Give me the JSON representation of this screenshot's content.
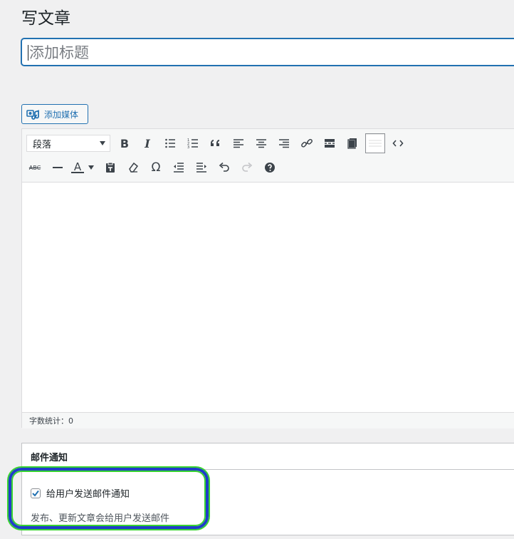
{
  "header": {
    "title": "写文章"
  },
  "title_field": {
    "placeholder": "添加标题"
  },
  "add_media": {
    "label": "添加媒体"
  },
  "toolbar": {
    "format_select": "段落",
    "row1_icons": [
      "bold-icon",
      "italic-icon",
      "bullet-list-icon",
      "numbered-list-icon",
      "blockquote-icon",
      "align-left-icon",
      "align-center-icon",
      "align-right-icon",
      "link-icon",
      "read-more-icon",
      "toolbar-toggle-icon",
      "fullscreen-icon",
      "code-icon"
    ],
    "row2_icons": [
      "strikethrough-icon",
      "horizontal-line-icon",
      "text-color-icon",
      "paste-text-icon",
      "clear-formatting-icon",
      "special-character-icon",
      "outdent-icon",
      "indent-icon",
      "undo-icon",
      "redo-icon",
      "help-icon"
    ],
    "strikethrough_text": "ABC",
    "bold_text": "B",
    "italic_text": "I",
    "text_color_text": "A",
    "omega_text": "Ω"
  },
  "editor": {
    "word_count": "字数统计：0"
  },
  "mail_box": {
    "title": "邮件通知",
    "checkbox_label": "给用户发送邮件通知",
    "checked": true,
    "description": "发布、更新文章会给用户发送邮件"
  },
  "colors": {
    "accent": "#2271b1",
    "highlight_border": "#1f3ec8",
    "highlight_glow": "#38d430"
  }
}
